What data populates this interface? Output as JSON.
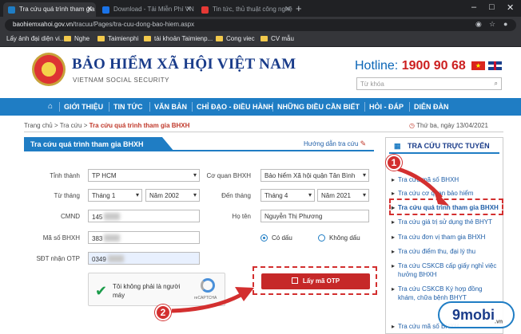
{
  "browser": {
    "tabs": [
      {
        "title": "Tra cứu quá trình tham gia BHXH",
        "active": true
      },
      {
        "title": "Download - Tải Miễn Phí VN - Ph",
        "active": false
      },
      {
        "title": "Tin tức, thủ thuật công nghệ mớ",
        "active": false
      }
    ],
    "new_tab": "+",
    "url_host": "baohiemxahoi.gov.vn",
    "url_path": "/tracuu/Pages/tra-cuu-dong-bao-hiem.aspx",
    "bookmarks": [
      "Lấy ảnh đại diện vi...",
      "Nghe",
      "Taimienphi",
      "tài khoản Taimienp...",
      "Cong viec",
      "CV mẫu"
    ]
  },
  "header": {
    "brand": "BẢO HIỂM XÃ HỘI VIỆT NAM",
    "brand_sub": "VIETNAM SOCIAL SECURITY",
    "hotline_label": "Hotline:",
    "hotline_number": "1900 90 68",
    "search_placeholder": "Từ khóa"
  },
  "nav": {
    "items": [
      "GIỚI THIỆU",
      "TIN TỨC",
      "VĂN BẢN",
      "CHỈ ĐẠO - ĐIỀU HÀNH",
      "NHỮNG ĐIỀU CẦN BIẾT",
      "HỎI - ĐÁP",
      "DIỄN ĐÀN"
    ]
  },
  "breadcrumb": {
    "home": "Trang chủ",
    "sep": ">",
    "level1": "Tra cứu",
    "current": "Tra cứu quá trình tham gia BHXH",
    "date": "Thứ ba, ngày 13/04/2021"
  },
  "form": {
    "title": "Tra cứu quá trình tham gia BHXH",
    "guide": "Hướng dẫn tra cứu",
    "tinh_thanh_label": "Tỉnh thành",
    "tinh_thanh_value": "TP HCM",
    "co_quan_label": "Cơ quan BHXH",
    "co_quan_value": "Bảo hiểm Xã hội quận Tân Bình",
    "tu_thang_label": "Từ tháng",
    "tu_thang_value": "Tháng 1",
    "tu_nam_value": "Năm 2002",
    "den_thang_label": "Đến tháng",
    "den_thang_value": "Tháng 4",
    "den_nam_value": "Năm 2021",
    "cmnd_label": "CMND",
    "cmnd_value": "145",
    "ho_ten_label": "Họ tên",
    "ho_ten_value": "Nguyễn Thị Phương",
    "ma_so_label": "Mã số BHXH",
    "ma_so_value": "383",
    "radio_co_dau": "Có dấu",
    "radio_khong_dau": "Không dấu",
    "sdt_label": "SĐT nhận OTP",
    "sdt_value": "0349",
    "captcha_text": "Tôi không phải là người máy",
    "captcha_brand": "reCAPTCHA",
    "otp_button": "Lấy mã OTP"
  },
  "sidebar": {
    "title": "TRA CỨU TRỰC TUYẾN",
    "items": [
      "Tra cứu mã số BHXH",
      "Tra cứu cơ quan bảo hiểm",
      "Tra cứu quá trình tham gia BHXH",
      "Tra cứu giá trị sử dụng thẻ BHYT",
      "Tra cứu đơn vị tham gia BHXH",
      "Tra cứu điểm thu, đại lý thu",
      "Tra cứu CSKCB cấp giấy nghỉ việc hưởng BHXH",
      "Tra cứu CSKCB Ký hợp đồng khám, chữa bệnh BHYT",
      "Tra cứu mã số BHXH"
    ]
  },
  "annotations": {
    "step1": "1",
    "step2": "2",
    "arrow_color": "#d32f2f"
  },
  "watermark": {
    "brand": "9mobi",
    "domain": ".vn"
  }
}
